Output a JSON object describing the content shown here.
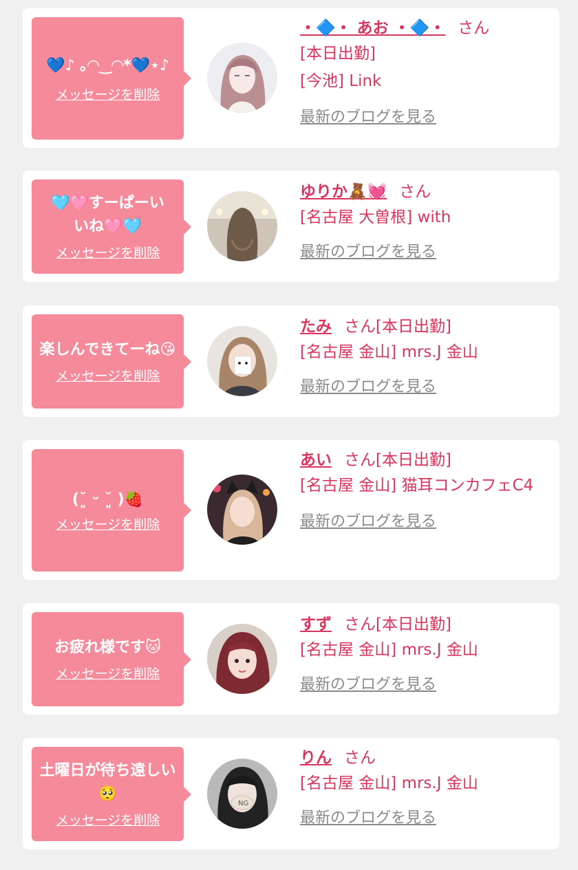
{
  "delete_label": "メッセージを削除",
  "blog_label": "最新のブログを見る",
  "san": "さん",
  "entries": [
    {
      "message": "💙♪ ｡◠‿◠*💙⋆♪",
      "name": "・🔷・ あお ・🔷・",
      "status": "[本日出勤]",
      "shop": "[今池] Link",
      "avatar": "illustration-woman-avatar"
    },
    {
      "message": "🩵🩷すーぱーいいね🩷🩵",
      "name": "ゆりか🧸💓",
      "status": "",
      "shop": "[名古屋 大曽根] with",
      "avatar": "woman-back-hair-avatar"
    },
    {
      "message": "楽しんできてーね😘",
      "name": "たみ",
      "status": "[本日出勤]",
      "shop": "[名古屋 金山] mrs.J 金山",
      "avatar": "woman-with-box-avatar"
    },
    {
      "message": "(˘͈ ᵕ ˘͈ )🍓",
      "name": "あい",
      "status": "[本日出勤]",
      "shop": "[名古屋 金山] 猫耳コンカフェC4",
      "avatar": "woman-cat-ears-avatar"
    },
    {
      "message": "お疲れ様です🐱",
      "name": "すず",
      "status": "[本日出勤]",
      "shop": "[名古屋 金山] mrs.J 金山",
      "avatar": "woman-red-hair-avatar"
    },
    {
      "message": "土曜日が待ち遠しい🥺",
      "name": "りん",
      "status": "",
      "shop": "[名古屋 金山] mrs.J 金山",
      "avatar": "woman-masked-avatar"
    }
  ]
}
